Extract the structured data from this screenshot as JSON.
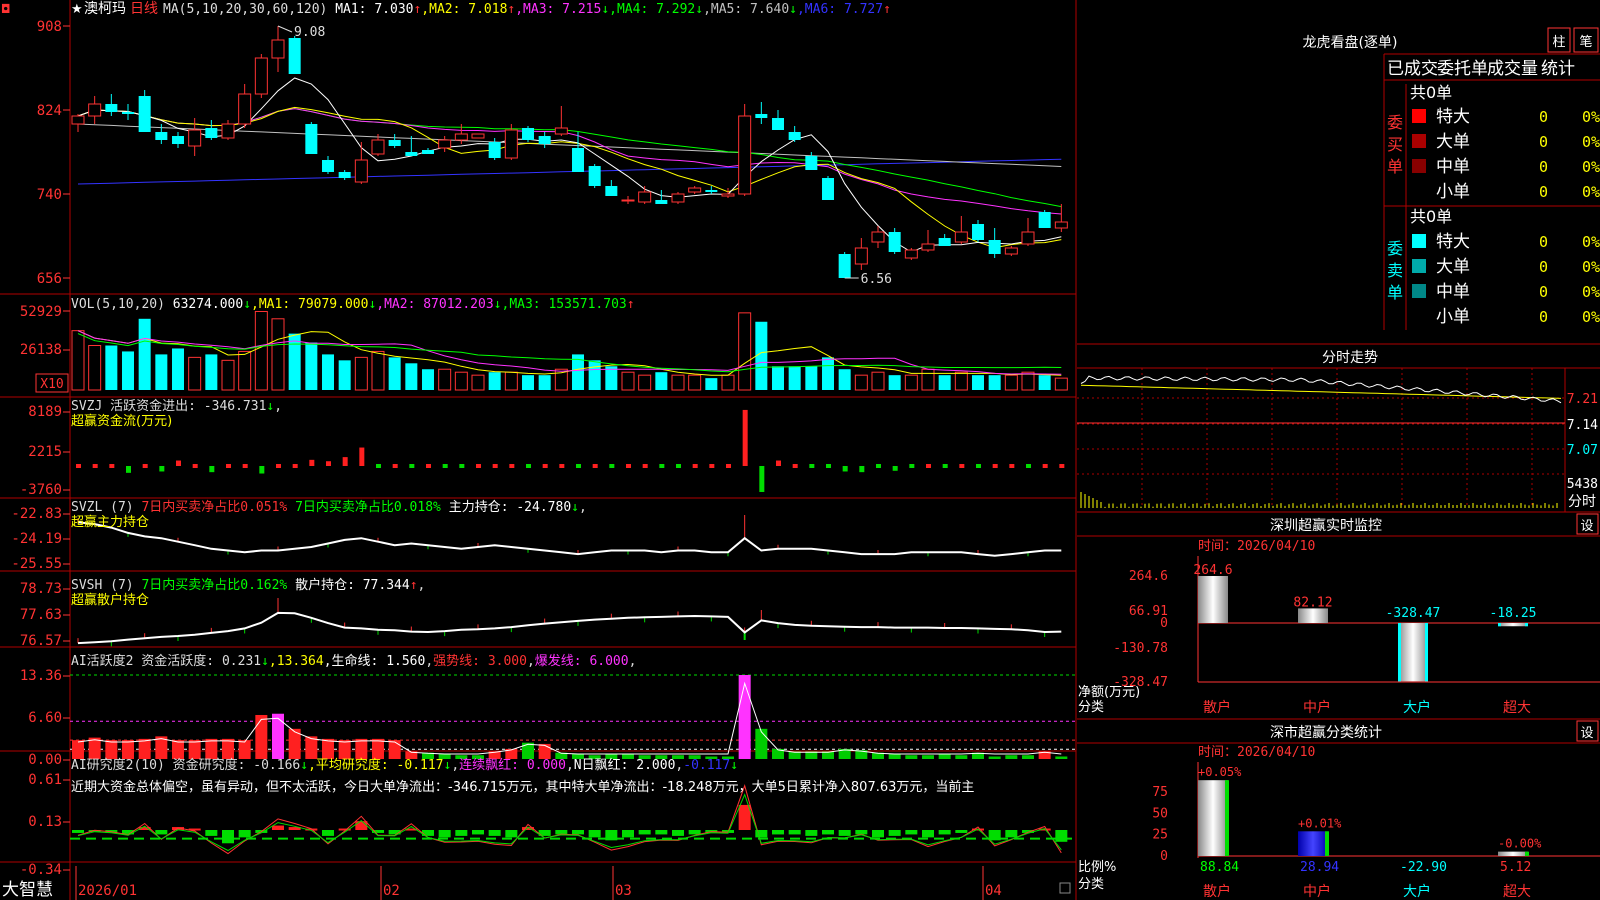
{
  "app": {
    "logo": "大智慧",
    "corner_mark": "◘"
  },
  "stock": {
    "star": "★",
    "name": "澳柯玛",
    "period": "日线"
  },
  "colors": {
    "up": "#ff3333",
    "down": "#00ffff",
    "panel_border": "#b00000",
    "ma1": "#ffffff",
    "ma2": "#ffff00",
    "ma3": "#ff33ff",
    "ma4": "#00ff00",
    "ma5": "#c0c0c0",
    "ma6": "#3333ff"
  },
  "main_chart": {
    "header": [
      {
        "text": "MA(5,10,20,30,60,120)",
        "color": "#dddddd"
      },
      {
        "text": " MA1: 7.030",
        "color": "#ffffff"
      },
      {
        "text": "↑",
        "color": "#ff3333"
      },
      {
        "text": ",MA2: 7.018",
        "color": "#ffff00"
      },
      {
        "text": "↑",
        "color": "#ff3333"
      },
      {
        "text": ",MA3: 7.215",
        "color": "#ff33ff"
      },
      {
        "text": "↓",
        "color": "#00ff00"
      },
      {
        "text": ",MA4: 7.292",
        "color": "#00ff00"
      },
      {
        "text": "↓",
        "color": "#00ff00"
      },
      {
        "text": ",MA5: 7.640",
        "color": "#c0c0c0"
      },
      {
        "text": "↓",
        "color": "#00ff00"
      },
      {
        "text": ",MA6: 7.727",
        "color": "#3333ff"
      },
      {
        "text": "↑",
        "color": "#ff3333"
      }
    ],
    "y_ticks": [
      "908",
      "824",
      "740",
      "656"
    ],
    "y_values": [
      9.08,
      8.24,
      7.4,
      6.56
    ],
    "high_label": "9.08",
    "low_label": "6.56"
  },
  "chart_data": {
    "type": "candlestick",
    "x_labels": [
      "2026/01",
      "02",
      "03",
      "04"
    ],
    "ohlc": [
      [
        8.1,
        8.2,
        8.02,
        8.18
      ],
      [
        8.18,
        8.38,
        8.1,
        8.3
      ],
      [
        8.3,
        8.4,
        8.18,
        8.22
      ],
      [
        8.22,
        8.3,
        8.14,
        8.2
      ],
      [
        8.38,
        8.44,
        8.02,
        8.02
      ],
      [
        8.02,
        8.1,
        7.9,
        7.94
      ],
      [
        7.98,
        8.02,
        7.86,
        7.9
      ],
      [
        7.88,
        8.16,
        7.78,
        8.04
      ],
      [
        8.06,
        8.14,
        7.94,
        7.96
      ],
      [
        7.96,
        8.14,
        7.94,
        8.1
      ],
      [
        8.1,
        8.5,
        8.06,
        8.4
      ],
      [
        8.4,
        8.8,
        8.36,
        8.76
      ],
      [
        8.76,
        9.08,
        8.62,
        8.94
      ],
      [
        8.96,
        8.98,
        8.62,
        8.6
      ],
      [
        8.1,
        8.12,
        7.8,
        7.8
      ],
      [
        7.74,
        7.78,
        7.6,
        7.62
      ],
      [
        7.62,
        7.64,
        7.54,
        7.56
      ],
      [
        7.52,
        7.92,
        7.5,
        7.74
      ],
      [
        7.8,
        8.0,
        7.78,
        7.94
      ],
      [
        7.94,
        8.0,
        7.86,
        7.88
      ],
      [
        7.82,
        7.98,
        7.78,
        7.78
      ],
      [
        7.84,
        7.86,
        7.8,
        7.8
      ],
      [
        7.86,
        7.98,
        7.82,
        7.94
      ],
      [
        7.94,
        8.1,
        7.9,
        8.0
      ],
      [
        7.96,
        8.0,
        7.96,
        8.0
      ],
      [
        7.92,
        7.96,
        7.74,
        7.76
      ],
      [
        7.76,
        8.1,
        7.74,
        8.04
      ],
      [
        8.06,
        8.08,
        7.92,
        7.94
      ],
      [
        7.98,
        8.02,
        7.86,
        7.9
      ],
      [
        8.0,
        8.28,
        7.98,
        8.06
      ],
      [
        7.86,
        8.02,
        7.86,
        7.62
      ],
      [
        7.68,
        7.7,
        7.46,
        7.48
      ],
      [
        7.48,
        7.54,
        7.38,
        7.38
      ],
      [
        7.34,
        7.38,
        7.3,
        7.34
      ],
      [
        7.32,
        7.48,
        7.3,
        7.42
      ],
      [
        7.34,
        7.44,
        7.3,
        7.3
      ],
      [
        7.32,
        7.42,
        7.3,
        7.4
      ],
      [
        7.42,
        7.48,
        7.4,
        7.46
      ],
      [
        7.44,
        7.48,
        7.4,
        7.42
      ],
      [
        7.38,
        7.46,
        7.36,
        7.4
      ],
      [
        7.4,
        8.3,
        7.38,
        8.18
      ],
      [
        8.2,
        8.32,
        8.1,
        8.16
      ],
      [
        8.16,
        8.24,
        8.04,
        8.04
      ],
      [
        8.02,
        8.08,
        7.92,
        7.94
      ],
      [
        7.78,
        7.82,
        7.64,
        7.64
      ],
      [
        7.56,
        7.58,
        7.34,
        7.34
      ],
      [
        6.8,
        6.82,
        6.56,
        6.56
      ],
      [
        6.7,
        6.96,
        6.64,
        6.86
      ],
      [
        6.92,
        7.08,
        6.86,
        7.02
      ],
      [
        7.02,
        7.06,
        6.8,
        6.82
      ],
      [
        6.76,
        6.86,
        6.74,
        6.84
      ],
      [
        6.84,
        7.04,
        6.82,
        6.9
      ],
      [
        6.96,
        7.0,
        6.88,
        6.88
      ],
      [
        6.92,
        7.18,
        6.9,
        7.02
      ],
      [
        7.1,
        7.14,
        6.92,
        6.94
      ],
      [
        6.94,
        7.06,
        6.76,
        6.8
      ],
      [
        6.8,
        6.88,
        6.78,
        6.86
      ],
      [
        6.9,
        7.16,
        6.88,
        7.02
      ],
      [
        7.22,
        7.24,
        7.06,
        7.06
      ],
      [
        7.06,
        7.3,
        7.02,
        7.12
      ]
    ],
    "volume": [
      40000,
      30000,
      30000,
      26000,
      48000,
      24000,
      28000,
      22000,
      24000,
      20000,
      26000,
      52929,
      48000,
      38000,
      32000,
      24000,
      20000,
      22000,
      26000,
      22000,
      18000,
      14000,
      14000,
      12000,
      10000,
      12000,
      12000,
      10000,
      10000,
      14000,
      24000,
      20000,
      16000,
      12000,
      10000,
      12000,
      10000,
      10000,
      8000,
      10000,
      52000,
      46000,
      16000,
      16000,
      16000,
      22000,
      14000,
      10000,
      12000,
      10000,
      10000,
      14000,
      10000,
      12000,
      10000,
      10000,
      10000,
      12000,
      10000,
      8000
    ],
    "volume_ticks": [
      "52929",
      "26138"
    ],
    "volume_unit": "X10",
    "volume_ma": {
      "MA1": 79079.0,
      "MA2": 87012.203,
      "MA3": 153571.703
    }
  },
  "vol_panel": {
    "header": [
      {
        "text": "VOL(5,10,20)",
        "color": "#dddddd"
      },
      {
        "text": " 63274.000",
        "color": "#ffffff"
      },
      {
        "text": "↓",
        "color": "#00ff00"
      },
      {
        "text": ",MA1: 79079.000",
        "color": "#ffff00"
      },
      {
        "text": "↓",
        "color": "#00ff00"
      },
      {
        "text": ",MA2: 87012.203",
        "color": "#ff33ff"
      },
      {
        "text": "↓",
        "color": "#00ff00"
      },
      {
        "text": ",MA3: 153571.703",
        "color": "#00ff00"
      },
      {
        "text": "↑",
        "color": "#ff3333"
      }
    ]
  },
  "svzj_panel": {
    "header": [
      {
        "text": "SVZJ  活跃资金进出: -346.731",
        "color": "#dddddd"
      },
      {
        "text": "↓",
        "color": "#00ff00"
      },
      {
        "text": ",",
        "color": "#dddddd"
      }
    ],
    "subtitle": "超赢资金流(万元)",
    "y_ticks": [
      "8189",
      "2215",
      "-3760"
    ],
    "values": [
      0.6,
      0.2,
      0.6,
      -1.0,
      0.5,
      -0.8,
      0.8,
      0.4,
      -0.9,
      0.3,
      0.3,
      -1.1,
      0.3,
      0.5,
      0.9,
      0.7,
      1.3,
      2.7,
      -0.4,
      0.4,
      -0.3,
      0.5,
      -0.3,
      -0.6,
      0.5,
      0.6,
      0.5,
      -0.6,
      0.4,
      0.3,
      -0.3,
      0.6,
      -0.3,
      0.3,
      0.3,
      -0.3,
      -0.6,
      0.3,
      0.5,
      0.3,
      8.2,
      -3.8,
      0.8,
      0.3,
      -0.3,
      -0.4,
      -0.8,
      -0.9,
      -0.4,
      -0.7,
      -0.3,
      0.4,
      -0.5,
      0.3,
      -0.5,
      0.3,
      0.4,
      -0.4,
      0.6,
      0.3
    ]
  },
  "svzl_panel": {
    "header": [
      {
        "text": "SVZL (7) ",
        "color": "#dddddd"
      },
      {
        "text": "7日内买卖净占比0.051%",
        "color": "#ff3333"
      },
      {
        "text": " 7日内买卖净占比0.018%",
        "color": "#00ff00"
      },
      {
        "text": " 主力持仓: -24.780",
        "color": "#ffffff"
      },
      {
        "text": "↓",
        "color": "#00ff00"
      },
      {
        "text": ",",
        "color": "#dddddd"
      }
    ],
    "subtitle": "超赢主力持仓",
    "y_ticks": [
      "-22.83",
      "-24.19",
      "-25.55"
    ],
    "line": [
      -23.3,
      -23.4,
      -23.6,
      -23.9,
      -24.1,
      -24.2,
      -24.4,
      -24.6,
      -24.8,
      -24.9,
      -25.0,
      -24.9,
      -24.9,
      -24.8,
      -24.7,
      -24.5,
      -24.3,
      -24.2,
      -24.4,
      -24.6,
      -24.5,
      -24.6,
      -24.7,
      -24.8,
      -24.7,
      -24.6,
      -24.7,
      -24.8,
      -24.9,
      -25.0,
      -25.1,
      -25.0,
      -24.9,
      -24.9,
      -24.9,
      -25.0,
      -24.9,
      -24.9,
      -25.0,
      -25.0,
      -24.2,
      -24.9,
      -24.8,
      -24.8,
      -24.8,
      -24.9,
      -25.0,
      -25.1,
      -25.1,
      -25.1,
      -25.0,
      -25.0,
      -25.0,
      -25.0,
      -25.1,
      -25.2,
      -25.1,
      -25.0,
      -24.9,
      -24.9
    ]
  },
  "svsh_panel": {
    "header": [
      {
        "text": "SVSH (7) ",
        "color": "#dddddd"
      },
      {
        "text": "7日内买卖净占比0.162%",
        "color": "#00ff00"
      },
      {
        "text": " 散户持仓: 77.344",
        "color": "#ffffff"
      },
      {
        "text": "↑",
        "color": "#ff3333"
      },
      {
        "text": ",",
        "color": "#dddddd"
      }
    ],
    "subtitle": "超赢散户持仓",
    "y_ticks": [
      "78.73",
      "77.63",
      "76.57"
    ],
    "line": [
      76.7,
      76.74,
      76.78,
      76.86,
      76.92,
      76.98,
      77.02,
      77.08,
      77.16,
      77.24,
      77.36,
      77.62,
      78.06,
      78.04,
      77.84,
      77.6,
      77.4,
      77.36,
      77.3,
      77.28,
      77.22,
      77.2,
      77.24,
      77.3,
      77.32,
      77.36,
      77.42,
      77.5,
      77.58,
      77.64,
      77.7,
      77.76,
      77.8,
      77.84,
      77.86,
      77.88,
      77.9,
      77.92,
      77.9,
      77.88,
      77.18,
      77.72,
      77.6,
      77.52,
      77.48,
      77.46,
      77.44,
      77.42,
      77.42,
      77.4,
      77.4,
      77.4,
      77.38,
      77.38,
      77.36,
      77.34,
      77.32,
      77.28,
      77.2,
      77.22
    ]
  },
  "ai_active_panel": {
    "header": [
      {
        "text": "AI活跃度2 资金活跃度: 0.231",
        "color": "#dddddd"
      },
      {
        "text": "↓",
        "color": "#00ff00"
      },
      {
        "text": ",13.364",
        "color": "#ffff00"
      },
      {
        "text": ",生命线: 1.560",
        "color": "#ffffff"
      },
      {
        "text": ",",
        "color": "#dddddd"
      },
      {
        "text": "强势线: 3.000",
        "color": "#ff3333"
      },
      {
        "text": ",",
        "color": "#dddddd"
      },
      {
        "text": "爆发线: 6.000",
        "color": "#ff33ff"
      },
      {
        "text": ",",
        "color": "#dddddd"
      }
    ],
    "y_ticks": [
      "13.36",
      "6.60",
      "0.00"
    ],
    "bars": [
      3.0,
      3.4,
      3.0,
      3.0,
      3.2,
      3.6,
      3.0,
      3.0,
      3.2,
      3.2,
      3.0,
      7.0,
      7.2,
      4.8,
      3.6,
      3.2,
      3.0,
      3.2,
      3.2,
      3.0,
      1.2,
      1.0,
      0.8,
      0.6,
      0.6,
      1.2,
      1.6,
      2.6,
      2.4,
      1.0,
      0.8,
      0.6,
      0.8,
      0.8,
      0.6,
      0.6,
      0.6,
      0.6,
      0.4,
      0.4,
      13.36,
      4.8,
      1.6,
      1.2,
      1.2,
      1.2,
      1.6,
      1.4,
      1.0,
      0.8,
      0.6,
      0.6,
      0.8,
      0.6,
      1.0,
      0.4,
      0.6,
      0.6,
      1.2,
      0.4
    ],
    "bar_colors": [
      "r",
      "r",
      "r",
      "r",
      "r",
      "r",
      "r",
      "r",
      "r",
      "r",
      "r",
      "r",
      "m",
      "r",
      "r",
      "r",
      "r",
      "r",
      "r",
      "r",
      "r",
      "g",
      "g",
      "g",
      "g",
      "r",
      "r",
      "g",
      "r",
      "g",
      "g",
      "g",
      "g",
      "g",
      "g",
      "g",
      "g",
      "g",
      "g",
      "g",
      "m",
      "g",
      "g",
      "g",
      "g",
      "g",
      "g",
      "g",
      "g",
      "g",
      "g",
      "g",
      "g",
      "g",
      "g",
      "g",
      "g",
      "g",
      "r",
      "g"
    ]
  },
  "ai_research_panel": {
    "header": [
      {
        "text": "AI研究度2(10) 资金研究度: -0.166",
        "color": "#dddddd"
      },
      {
        "text": "↓",
        "color": "#00ff00"
      },
      {
        "text": ",平均研究度: -0.117",
        "color": "#ffff00"
      },
      {
        "text": "↓",
        "color": "#00ff00"
      },
      {
        "text": ",",
        "color": "#dddddd"
      },
      {
        "text": "连续飘红: 0.000",
        "color": "#ff33ff"
      },
      {
        "text": ",",
        "color": "#dddddd"
      },
      {
        "text": "N日飘红: 2.000",
        "color": "#ffffff"
      },
      {
        "text": ",",
        "color": "#dddddd"
      },
      {
        "text": "-0.117",
        "color": "#3333ff"
      },
      {
        "text": "↓",
        "color": "#00ff00"
      }
    ],
    "comment": "近期大资金总体偏空，虽有异动，但不太活跃，今日大单净流出：-346.715万元，其中特大单净流出：-18.248万元，大单5日累计净入807.63万元，当前主",
    "y_ticks": [
      "0.61",
      "0.13",
      "-0.34"
    ],
    "bars": [
      -0.04,
      -0.02,
      -0.04,
      -0.06,
      0.04,
      -0.06,
      0.04,
      0.02,
      -0.08,
      -0.18,
      -0.1,
      -0.04,
      0.06,
      0.04,
      0.02,
      -0.08,
      0.02,
      0.12,
      -0.04,
      -0.06,
      0.02,
      -0.08,
      -0.1,
      -0.08,
      -0.06,
      -0.08,
      -0.1,
      0.04,
      -0.08,
      -0.06,
      -0.06,
      -0.1,
      -0.14,
      -0.1,
      -0.06,
      -0.06,
      -0.08,
      -0.06,
      -0.04,
      -0.04,
      0.34,
      -0.1,
      -0.06,
      -0.06,
      -0.08,
      -0.06,
      -0.08,
      -0.06,
      -0.1,
      -0.08,
      -0.06,
      -0.1,
      -0.06,
      -0.04,
      0.02,
      -0.14,
      -0.1,
      -0.04,
      0.02,
      -0.16
    ]
  },
  "dragon_tiger": {
    "title": "龙虎看盘(逐单)",
    "btn_bar": "柱",
    "btn_pen": "笔",
    "tab_labels": [
      "已成交",
      "委托单",
      "成交量",
      "统计"
    ],
    "buy_label": "委买单",
    "sell_label": "委卖单",
    "buy_total": "共0单",
    "sell_total": "共0单",
    "buy_rows": [
      {
        "label": "特大",
        "count": "0",
        "pct": "0%"
      },
      {
        "label": "大单",
        "count": "0",
        "pct": "0%"
      },
      {
        "label": "中单",
        "count": "0",
        "pct": "0%"
      },
      {
        "label": "小单",
        "count": "0",
        "pct": "0%"
      }
    ],
    "sell_rows": [
      {
        "label": "特大",
        "count": "0",
        "pct": "0%"
      },
      {
        "label": "大单",
        "count": "0",
        "pct": "0%"
      },
      {
        "label": "中单",
        "count": "0",
        "pct": "0%"
      },
      {
        "label": "小单",
        "count": "0",
        "pct": "0%"
      }
    ]
  },
  "intraday": {
    "title": "分时走势",
    "prices": [
      "7.21",
      "7.14",
      "7.07"
    ],
    "volume_label": "5438",
    "time_label": "分时"
  },
  "sz_monitor": {
    "title": "深圳超赢实时监控",
    "settings": "设",
    "time_text": "时间：2026/04/10",
    "y_ticks": [
      "264.6",
      "66.91",
      "0",
      "-130.78",
      "-328.47"
    ],
    "ylabel": "净额(万元)",
    "xlabel": "分类",
    "categories": [
      "散户",
      "中户",
      "大户",
      "超大"
    ],
    "values": [
      264.6,
      82.12,
      -328.47,
      -18.25
    ],
    "value_labels": [
      "264.6",
      "82.12",
      "-328.47",
      "-18.25"
    ]
  },
  "sh_stats": {
    "title": "深市超赢分类统计",
    "settings": "设",
    "time_text": "时间：2026/04/10",
    "y_ticks": [
      "75",
      "50",
      "25",
      "0"
    ],
    "ylabel": "比例%",
    "xlabel": "分类",
    "categories": [
      "散户",
      "中户",
      "大户",
      "超大"
    ],
    "bar_pcts": [
      88.84,
      28.94,
      0,
      5.12
    ],
    "top_labels": [
      "+0.05%",
      "+0.01%",
      "",
      "-0.00%"
    ],
    "bottom_labels": [
      "88.84",
      "28.94",
      "-22.90",
      "5.12"
    ]
  }
}
